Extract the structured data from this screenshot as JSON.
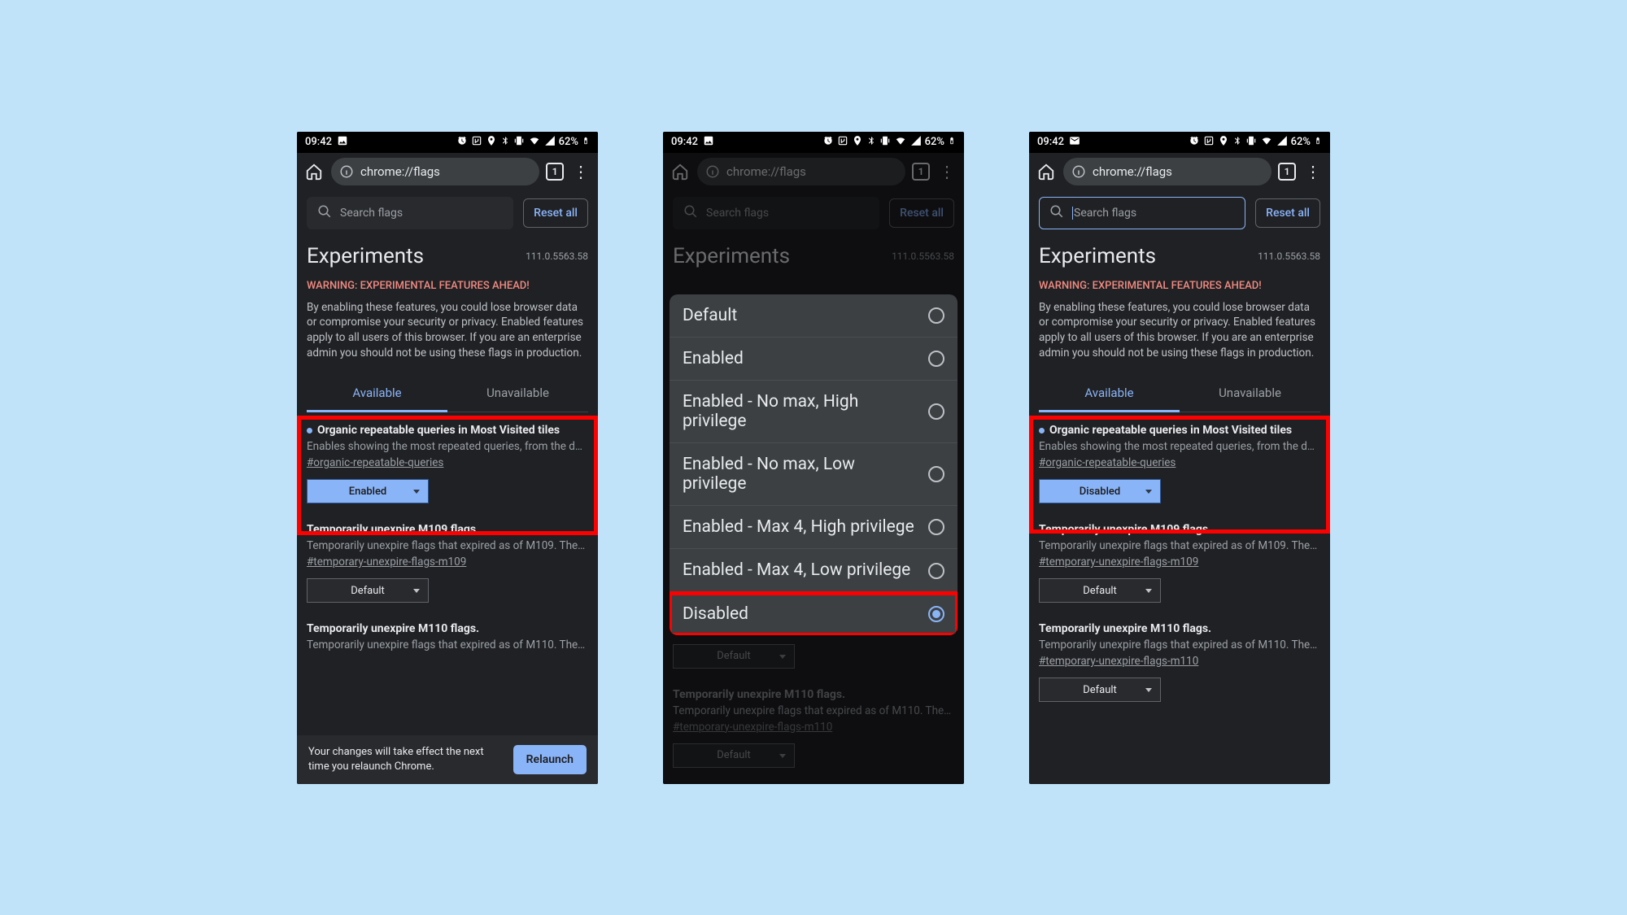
{
  "status": {
    "time": "09:42",
    "battery": "62%",
    "leftIcon1": "image-icon",
    "leftIcon2": "mail-icon"
  },
  "browser": {
    "url": "chrome://flags",
    "tabCount": "1"
  },
  "search": {
    "placeholder": "Search flags",
    "resetLabel": "Reset all"
  },
  "header": {
    "title": "Experiments",
    "version": "111.0.5563.58",
    "warning": "WARNING: EXPERIMENTAL FEATURES AHEAD!",
    "warningText": "By enabling these features, you could lose browser data or compromise your security or privacy. Enabled features apply to all users of this browser. If you are an enterprise admin you should not be using these flags in production."
  },
  "tabs": {
    "available": "Available",
    "unavailable": "Unavailable"
  },
  "flags": {
    "organic": {
      "title": "Organic repeatable queries in Most Visited tiles",
      "desc": "Enables showing the most repeated queries, from the d…",
      "hash": "#organic-repeatable-queries",
      "stateEnabled": "Enabled",
      "stateDisabled": "Disabled"
    },
    "m109": {
      "title": "Temporarily unexpire M109 flags.",
      "desc": "Temporarily unexpire flags that expired as of M109. The…",
      "hash": "#temporary-unexpire-flags-m109",
      "state": "Default"
    },
    "m110": {
      "title": "Temporarily unexpire M110 flags.",
      "desc": "Temporarily unexpire flags that expired as of M110. The…",
      "hash": "#temporary-unexpire-flags-m110",
      "state": "Default"
    }
  },
  "relaunch": {
    "text": "Your changes will take effect the next time you relaunch Chrome.",
    "button": "Relaunch"
  },
  "options": [
    "Default",
    "Enabled",
    "Enabled - No max, High privilege",
    "Enabled - No max, Low privilege",
    "Enabled - Max 4, High privilege",
    "Enabled - Max 4, Low privilege",
    "Disabled"
  ]
}
